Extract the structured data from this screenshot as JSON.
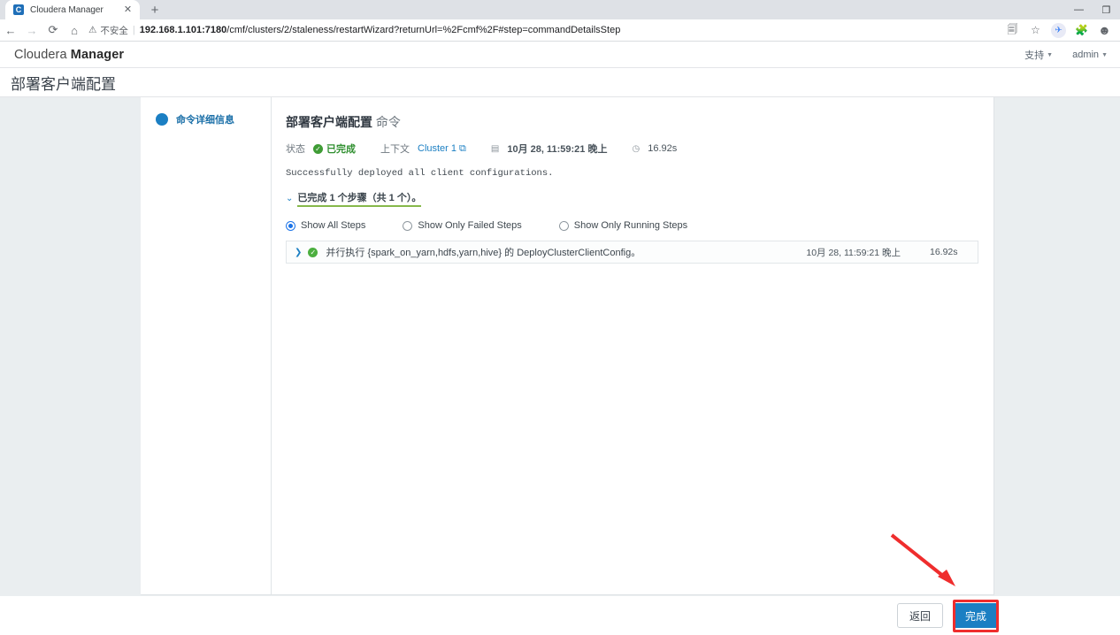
{
  "browser": {
    "tab": {
      "title": "Cloudera Manager",
      "favicon_letter": "C",
      "favicon_icon": "cloudera-favicon",
      "close_icon": "close-icon"
    },
    "new_tab_icon": "plus-icon",
    "window_controls": {
      "minimize": "minimize-icon",
      "maximize": "maximize-icon"
    },
    "nav": {
      "back": "back-arrow-icon",
      "forward": "forward-arrow-icon",
      "reload": "reload-icon",
      "home": "home-icon"
    },
    "omnibox": {
      "security_icon": "warning-triangle-icon",
      "security_label": "不安全",
      "url_host": "192.168.1.101:7180",
      "url_path": "/cmf/clusters/2/staleness/restartWizard?returnUrl=%2Fcmf%2F#step=commandDetailsStep"
    },
    "toolbar_icons": [
      "translate-icon",
      "bookmark-star-icon",
      "extension-blue-icon",
      "extensions-puzzle-icon",
      "profile-avatar-icon"
    ]
  },
  "app_header": {
    "brand_light": "Cloudera",
    "brand_bold": "Manager",
    "support_label": "支持",
    "user_label": "admin",
    "caret": "▾"
  },
  "page": {
    "title": "部署客户端配置"
  },
  "wizard": {
    "steps": [
      {
        "label": "命令详细信息",
        "state": "active"
      }
    ]
  },
  "command": {
    "title_bold": "部署客户端配置",
    "title_sub": "命令",
    "meta": {
      "status_label": "状态",
      "status_value": "已完成",
      "context_label": "上下文",
      "context_value": "Cluster 1",
      "context_external_icon": "external-link-icon",
      "calendar_icon": "calendar-icon",
      "timestamp": "10月 28, 11:59:21 晚上",
      "clock_icon": "clock-icon",
      "duration": "16.92s"
    },
    "message": "Successfully deployed all client configurations.",
    "steps_toggle": {
      "chevron_icon": "chevron-down-icon",
      "text": "已完成 1 个步骤（共 1 个）。"
    },
    "filters": [
      {
        "label": "Show All Steps",
        "selected": true
      },
      {
        "label": "Show Only Failed Steps",
        "selected": false
      },
      {
        "label": "Show Only Running Steps",
        "selected": false
      }
    ],
    "step_rows": [
      {
        "expand_icon": "chevron-right-icon",
        "status_icon": "check-circle-icon",
        "text": "并行执行 {spark_on_yarn,hdfs,yarn,hive} 的 DeployClusterClientConfig。",
        "timestamp": "10月 28, 11:59:21 晚上",
        "duration": "16.92s"
      }
    ]
  },
  "footer": {
    "back_label": "返回",
    "finish_label": "完成"
  },
  "annotation": {
    "arrow_color": "#ef2d2d",
    "highlight_color": "#ef2d2d",
    "target": "完成"
  },
  "colors": {
    "accent_blue": "#1b7fc3",
    "success_green": "#3f9c35",
    "page_bg": "#eaeef0",
    "panel_bg": "#ffffff"
  }
}
